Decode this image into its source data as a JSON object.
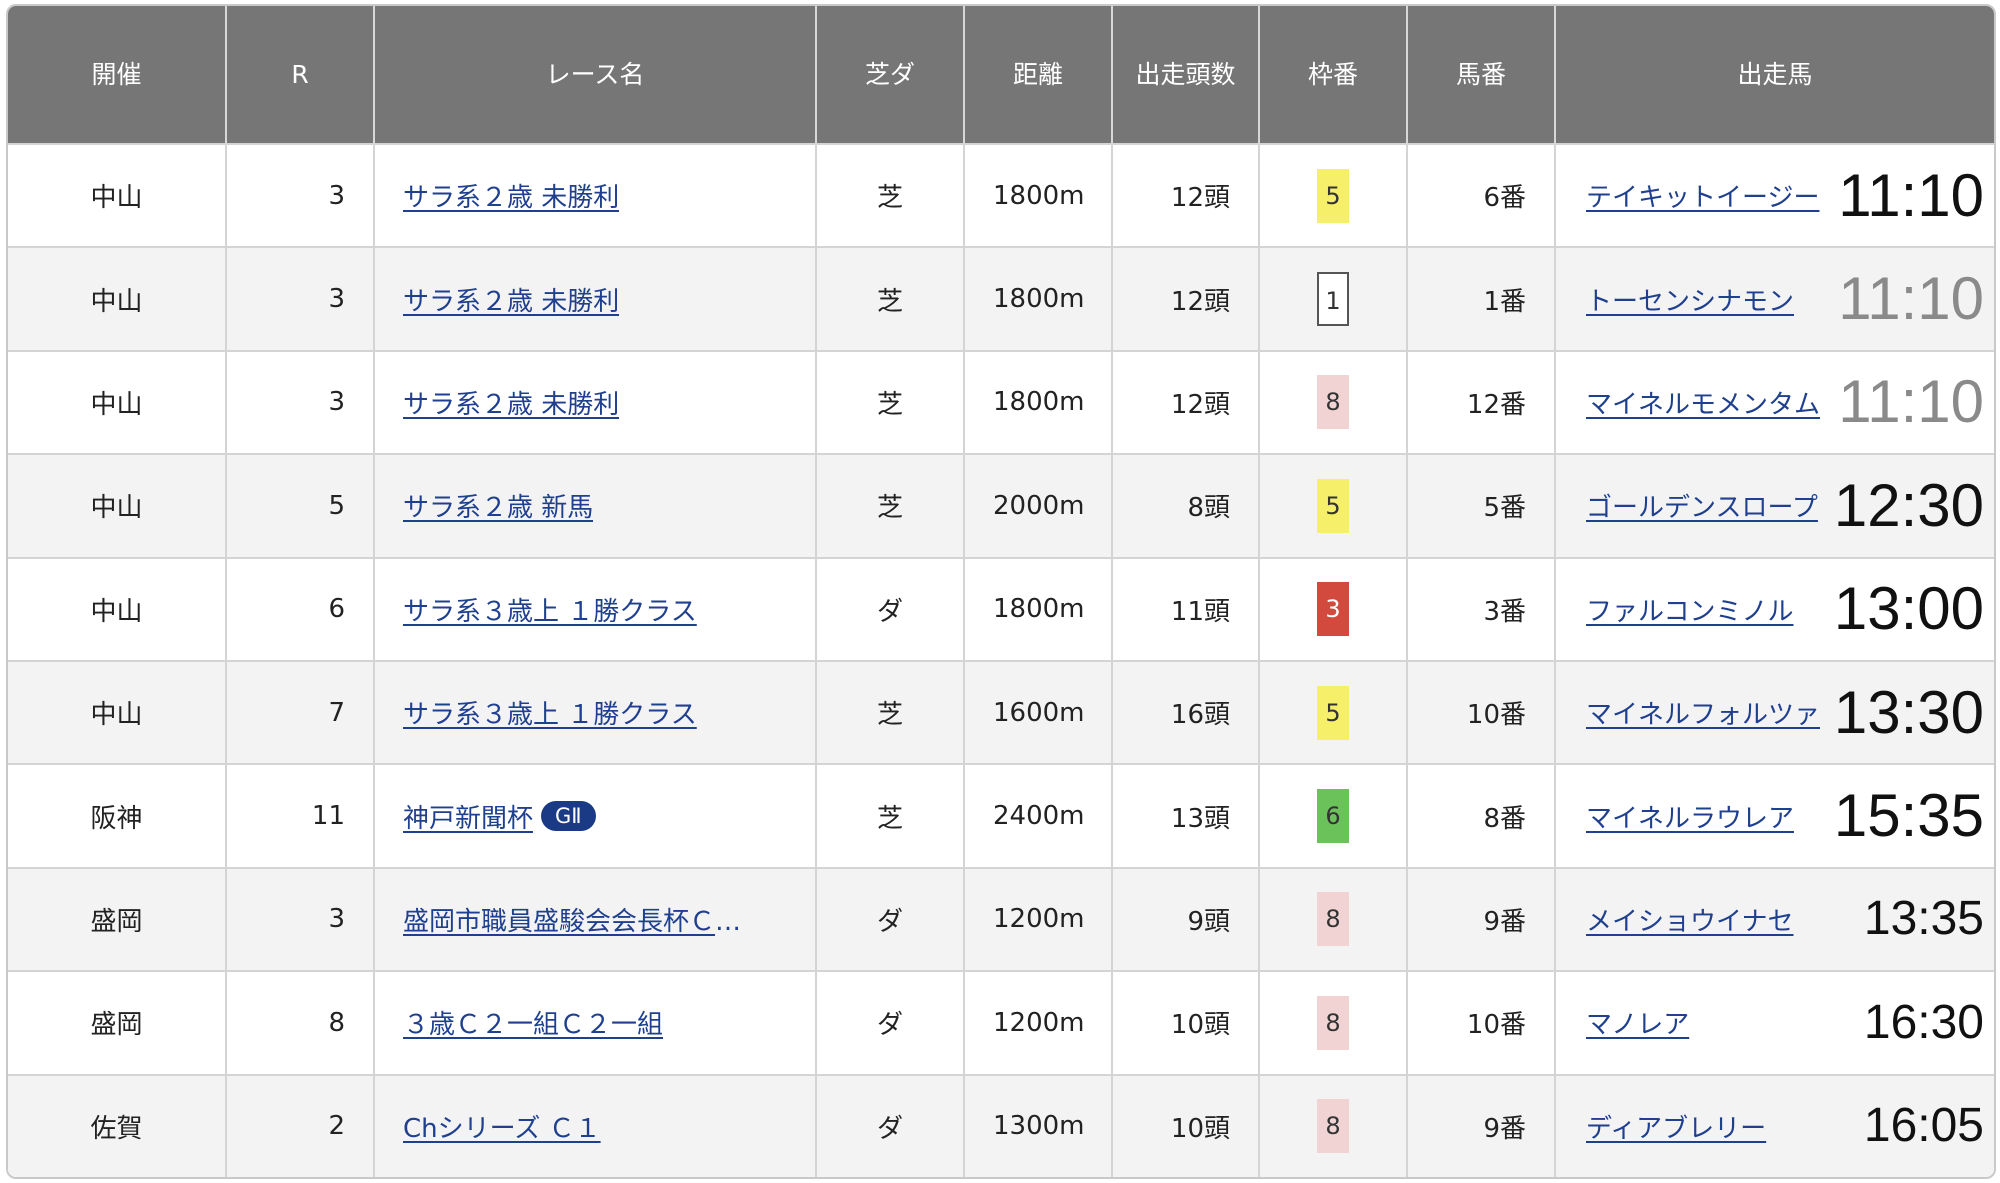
{
  "headers": [
    "開催",
    "R",
    "レース名",
    "芝ダ",
    "距離",
    "出走頭数",
    "枠番",
    "馬番",
    "出走馬"
  ],
  "rows": [
    {
      "venue": "中山",
      "r": "3",
      "race": "サラ系２歳 未勝利",
      "grade": "",
      "surface": "芝",
      "distance": "1800m",
      "runners": "12頭",
      "waku": "5",
      "waku_bg": "#f6ef6a",
      "waku_fg": "#333333",
      "waku_border": "none",
      "umaban": "6番",
      "horse": "テイキットイージー",
      "time": "11:10",
      "time_color": "#111111",
      "time_size": "60px"
    },
    {
      "venue": "中山",
      "r": "3",
      "race": "サラ系２歳 未勝利",
      "grade": "",
      "surface": "芝",
      "distance": "1800m",
      "runners": "12頭",
      "waku": "1",
      "waku_bg": "#ffffff",
      "waku_fg": "#333333",
      "waku_border": "2px solid #555555",
      "umaban": "1番",
      "horse": "トーセンシナモン",
      "time": "11:10",
      "time_color": "#8a8a8a",
      "time_size": "60px"
    },
    {
      "venue": "中山",
      "r": "3",
      "race": "サラ系２歳 未勝利",
      "grade": "",
      "surface": "芝",
      "distance": "1800m",
      "runners": "12頭",
      "waku": "8",
      "waku_bg": "#f2d3d3",
      "waku_fg": "#333333",
      "waku_border": "none",
      "umaban": "12番",
      "horse": "マイネルモメンタム",
      "time": "11:10",
      "time_color": "#8a8a8a",
      "time_size": "60px"
    },
    {
      "venue": "中山",
      "r": "5",
      "race": "サラ系２歳 新馬",
      "grade": "",
      "surface": "芝",
      "distance": "2000m",
      "runners": "8頭",
      "waku": "5",
      "waku_bg": "#f6ef6a",
      "waku_fg": "#333333",
      "waku_border": "none",
      "umaban": "5番",
      "horse": "ゴールデンスロープ",
      "time": "12:30",
      "time_color": "#111111",
      "time_size": "60px"
    },
    {
      "venue": "中山",
      "r": "6",
      "race": "サラ系３歳上 １勝クラス",
      "grade": "",
      "surface": "ダ",
      "distance": "1800m",
      "runners": "11頭",
      "waku": "3",
      "waku_bg": "#d24a3e",
      "waku_fg": "#ffffff",
      "waku_border": "none",
      "umaban": "3番",
      "horse": "ファルコンミノル",
      "time": "13:00",
      "time_color": "#111111",
      "time_size": "60px"
    },
    {
      "venue": "中山",
      "r": "7",
      "race": "サラ系３歳上 １勝クラス",
      "grade": "",
      "surface": "芝",
      "distance": "1600m",
      "runners": "16頭",
      "waku": "5",
      "waku_bg": "#f6ef6a",
      "waku_fg": "#333333",
      "waku_border": "none",
      "umaban": "10番",
      "horse": "マイネルフォルツァ",
      "time": "13:30",
      "time_color": "#111111",
      "time_size": "60px"
    },
    {
      "venue": "阪神",
      "r": "11",
      "race": "神戸新聞杯",
      "grade": "GⅡ",
      "surface": "芝",
      "distance": "2400m",
      "runners": "13頭",
      "waku": "6",
      "waku_bg": "#6cc25a",
      "waku_fg": "#333333",
      "waku_border": "none",
      "umaban": "8番",
      "horse": "マイネルラウレア",
      "time": "15:35",
      "time_color": "#111111",
      "time_size": "60px"
    },
    {
      "venue": "盛岡",
      "r": "3",
      "race": "盛岡市職員盛駿会会長杯Ｃ２…",
      "grade": "",
      "surface": "ダ",
      "distance": "1200m",
      "runners": "9頭",
      "waku": "8",
      "waku_bg": "#f2d3d3",
      "waku_fg": "#333333",
      "waku_border": "none",
      "umaban": "9番",
      "horse": "メイショウイナセ",
      "time": "13:35",
      "time_color": "#111111",
      "time_size": "48px"
    },
    {
      "venue": "盛岡",
      "r": "8",
      "race": "３歳Ｃ２一組Ｃ２一組",
      "grade": "",
      "surface": "ダ",
      "distance": "1200m",
      "runners": "10頭",
      "waku": "8",
      "waku_bg": "#f2d3d3",
      "waku_fg": "#333333",
      "waku_border": "none",
      "umaban": "10番",
      "horse": "マノレア",
      "time": "16:30",
      "time_color": "#111111",
      "time_size": "48px"
    },
    {
      "venue": "佐賀",
      "r": "2",
      "race": "Chシリーズ Ｃ１",
      "grade": "",
      "surface": "ダ",
      "distance": "1300m",
      "runners": "10頭",
      "waku": "8",
      "waku_bg": "#f2d3d3",
      "waku_fg": "#333333",
      "waku_border": "none",
      "umaban": "9番",
      "horse": "ディアブレリー",
      "time": "16:05",
      "time_color": "#111111",
      "time_size": "48px"
    }
  ]
}
